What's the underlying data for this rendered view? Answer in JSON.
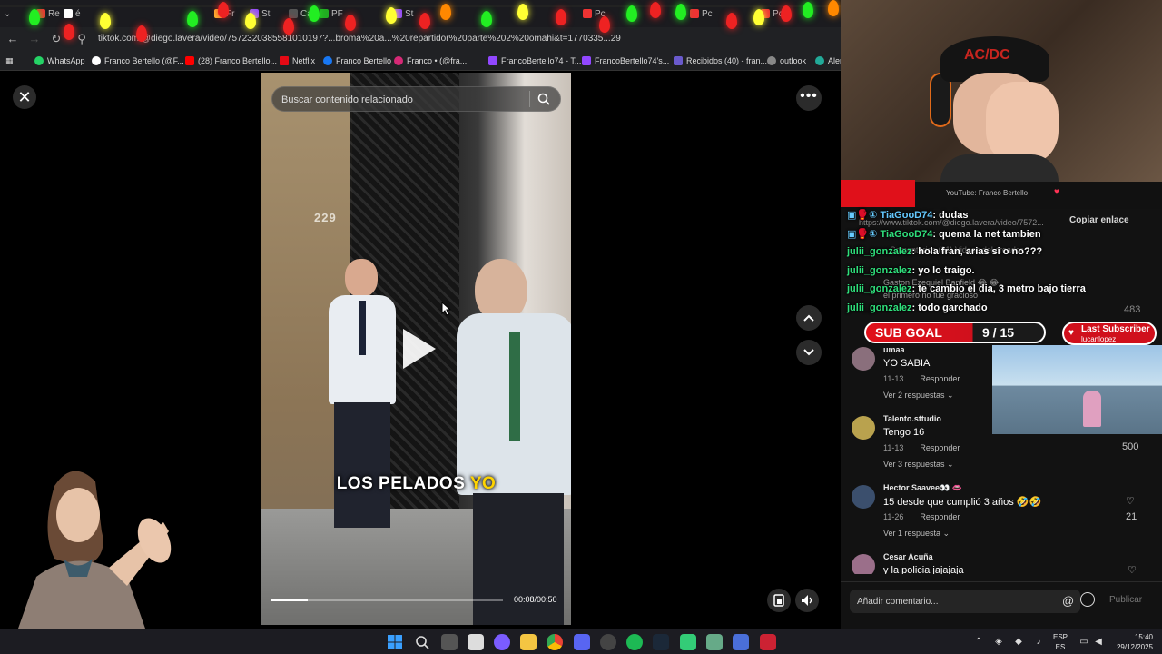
{
  "browser": {
    "tabs": [
      "Re",
      "é",
      "Fr",
      "St",
      "Ca",
      "PF",
      "St",
      "Pc",
      "Pc",
      "Pc"
    ],
    "url": "tiktok.com/@diego.lavera/video/7572320385581010197?...broma%20a...%20repartidor%20parte%202%20omahi&t=1770335...29",
    "bookmarks": [
      "WhatsApp",
      "Franco Bertello (@F...",
      "(28) Franco Bertello...",
      "Netflix",
      "Franco Bertello",
      "Franco • (@fra...",
      "FrancoBertello74 - T...",
      "FrancoBertello74's...",
      "Recibidos (40) - fran...",
      "outlook",
      "Aler"
    ]
  },
  "viewer": {
    "search_placeholder": "Buscar contenido relacionado",
    "caption_main": "LOS PELADOS ",
    "caption_highlight": "YO",
    "address_number": "229",
    "time": "00:08/00:50",
    "progress": 0.16,
    "close_glyph": "✕",
    "more_glyph": "•••"
  },
  "stream": {
    "hat_text": "AC/DC",
    "youtube_label": "YouTube: Franco Bertello",
    "copy_link": "Copiar enlace",
    "faded_url": "https://www.tiktok.com/@diego.lavera/video/7572...",
    "faded_tabs": "Comentarios (81)          Videos del creador",
    "faded_comment_name": "Gaston Ezequiel Banfield 😂 😂",
    "faded_comment_text": "el primero no fue gracioso",
    "faded_likes": "483",
    "chat": [
      {
        "user": "TiaGooD74",
        "message": ": dudas",
        "color": "u1",
        "badges": "▣🥊① "
      },
      {
        "user": "TiaGooD74",
        "message": ": quema la net tambien",
        "color": "u2",
        "badges": "▣🥊① "
      },
      {
        "user": "julii_gonzalez",
        "message": ": hola fran, arias si o no???",
        "color": "u2",
        "badges": ""
      },
      {
        "user": "julii_gonzalez",
        "message": ": yo lo traigo.",
        "color": "u2",
        "badges": ""
      },
      {
        "user": "julii_gonzalez",
        "message": ": te cambio el dia, 3 metro bajo tierra",
        "color": "u2",
        "badges": ""
      },
      {
        "user": "julii_gonzalez",
        "message": ": todo garchado",
        "color": "u2",
        "badges": ""
      }
    ],
    "sub_goal_label": "SUB GOAL",
    "sub_goal_count": "9 / 15",
    "sub_goal_progress": 0.6,
    "last_sub_title": "Last Subscriber",
    "last_sub_name": "lucanlopez"
  },
  "comments": [
    {
      "name": "umaa",
      "text": "YO SABIA",
      "date": "11-13",
      "reply": "Responder",
      "replies": "Ver 2 respuestas ⌄",
      "likes": ""
    },
    {
      "name": "Talento.sttudio",
      "text": "Tengo 16",
      "date": "11-13",
      "reply": "Responder",
      "replies": "Ver 3 respuestas ⌄",
      "likes": "500"
    },
    {
      "name": "Hector Saavee👀 👄",
      "text": "15 desde que cumplió 3 años 🤣🤣",
      "date": "11-26",
      "reply": "Responder",
      "replies": "Ver 1 respuesta ⌄",
      "likes": "21"
    },
    {
      "name": "Cesar Acuña",
      "text": "y la policia jajajaja",
      "date": "",
      "reply": "",
      "replies": "",
      "likes": ""
    }
  ],
  "comment_bar": {
    "placeholder": "Añadir comentario...",
    "publish": "Publicar",
    "at": "@"
  },
  "taskbar": {
    "lang_top": "ESP",
    "lang_bottom": "ES",
    "time": "15:40",
    "date": "29/12/2025"
  },
  "colors": {
    "accent_red": "#e0101a",
    "chat_green": "#2fe07c",
    "chat_blue": "#64c9ff"
  }
}
